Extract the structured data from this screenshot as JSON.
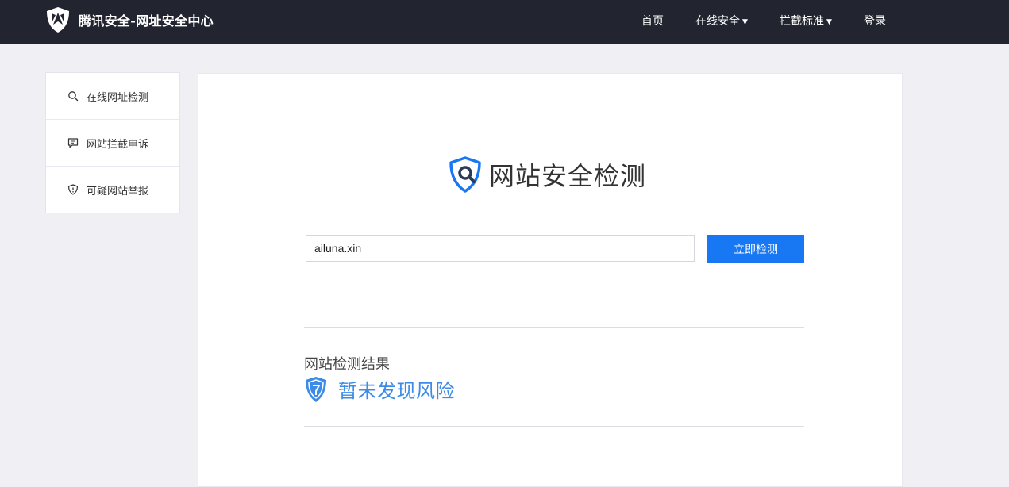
{
  "header": {
    "site_title": "腾讯安全-网址安全中心",
    "logo_icon": "tencent-security-shield-icon",
    "nav": [
      {
        "label": "首页",
        "has_dropdown": false
      },
      {
        "label": "在线安全",
        "has_dropdown": true
      },
      {
        "label": "拦截标准",
        "has_dropdown": true
      },
      {
        "label": "登录",
        "has_dropdown": false
      }
    ],
    "dropdown_glyph": "▼"
  },
  "sidebar": {
    "items": [
      {
        "label": "在线网址检测",
        "icon": "search-icon"
      },
      {
        "label": "网站拦截申诉",
        "icon": "chat-bubble-icon"
      },
      {
        "label": "可疑网站举报",
        "icon": "shield-alert-icon"
      }
    ]
  },
  "main": {
    "title": "网站安全检测",
    "title_icon": "shield-search-icon",
    "search": {
      "value": "ailuna.xin",
      "placeholder": ""
    },
    "submit_label": "立即检测",
    "result": {
      "heading": "网站检测结果",
      "status": "暂未发现风险",
      "status_icon": "shield-check-icon"
    }
  },
  "colors": {
    "header_bg": "#22252f",
    "page_bg": "#f0f0f4",
    "accent": "#1877f2",
    "result_text": "#3d8be8"
  }
}
